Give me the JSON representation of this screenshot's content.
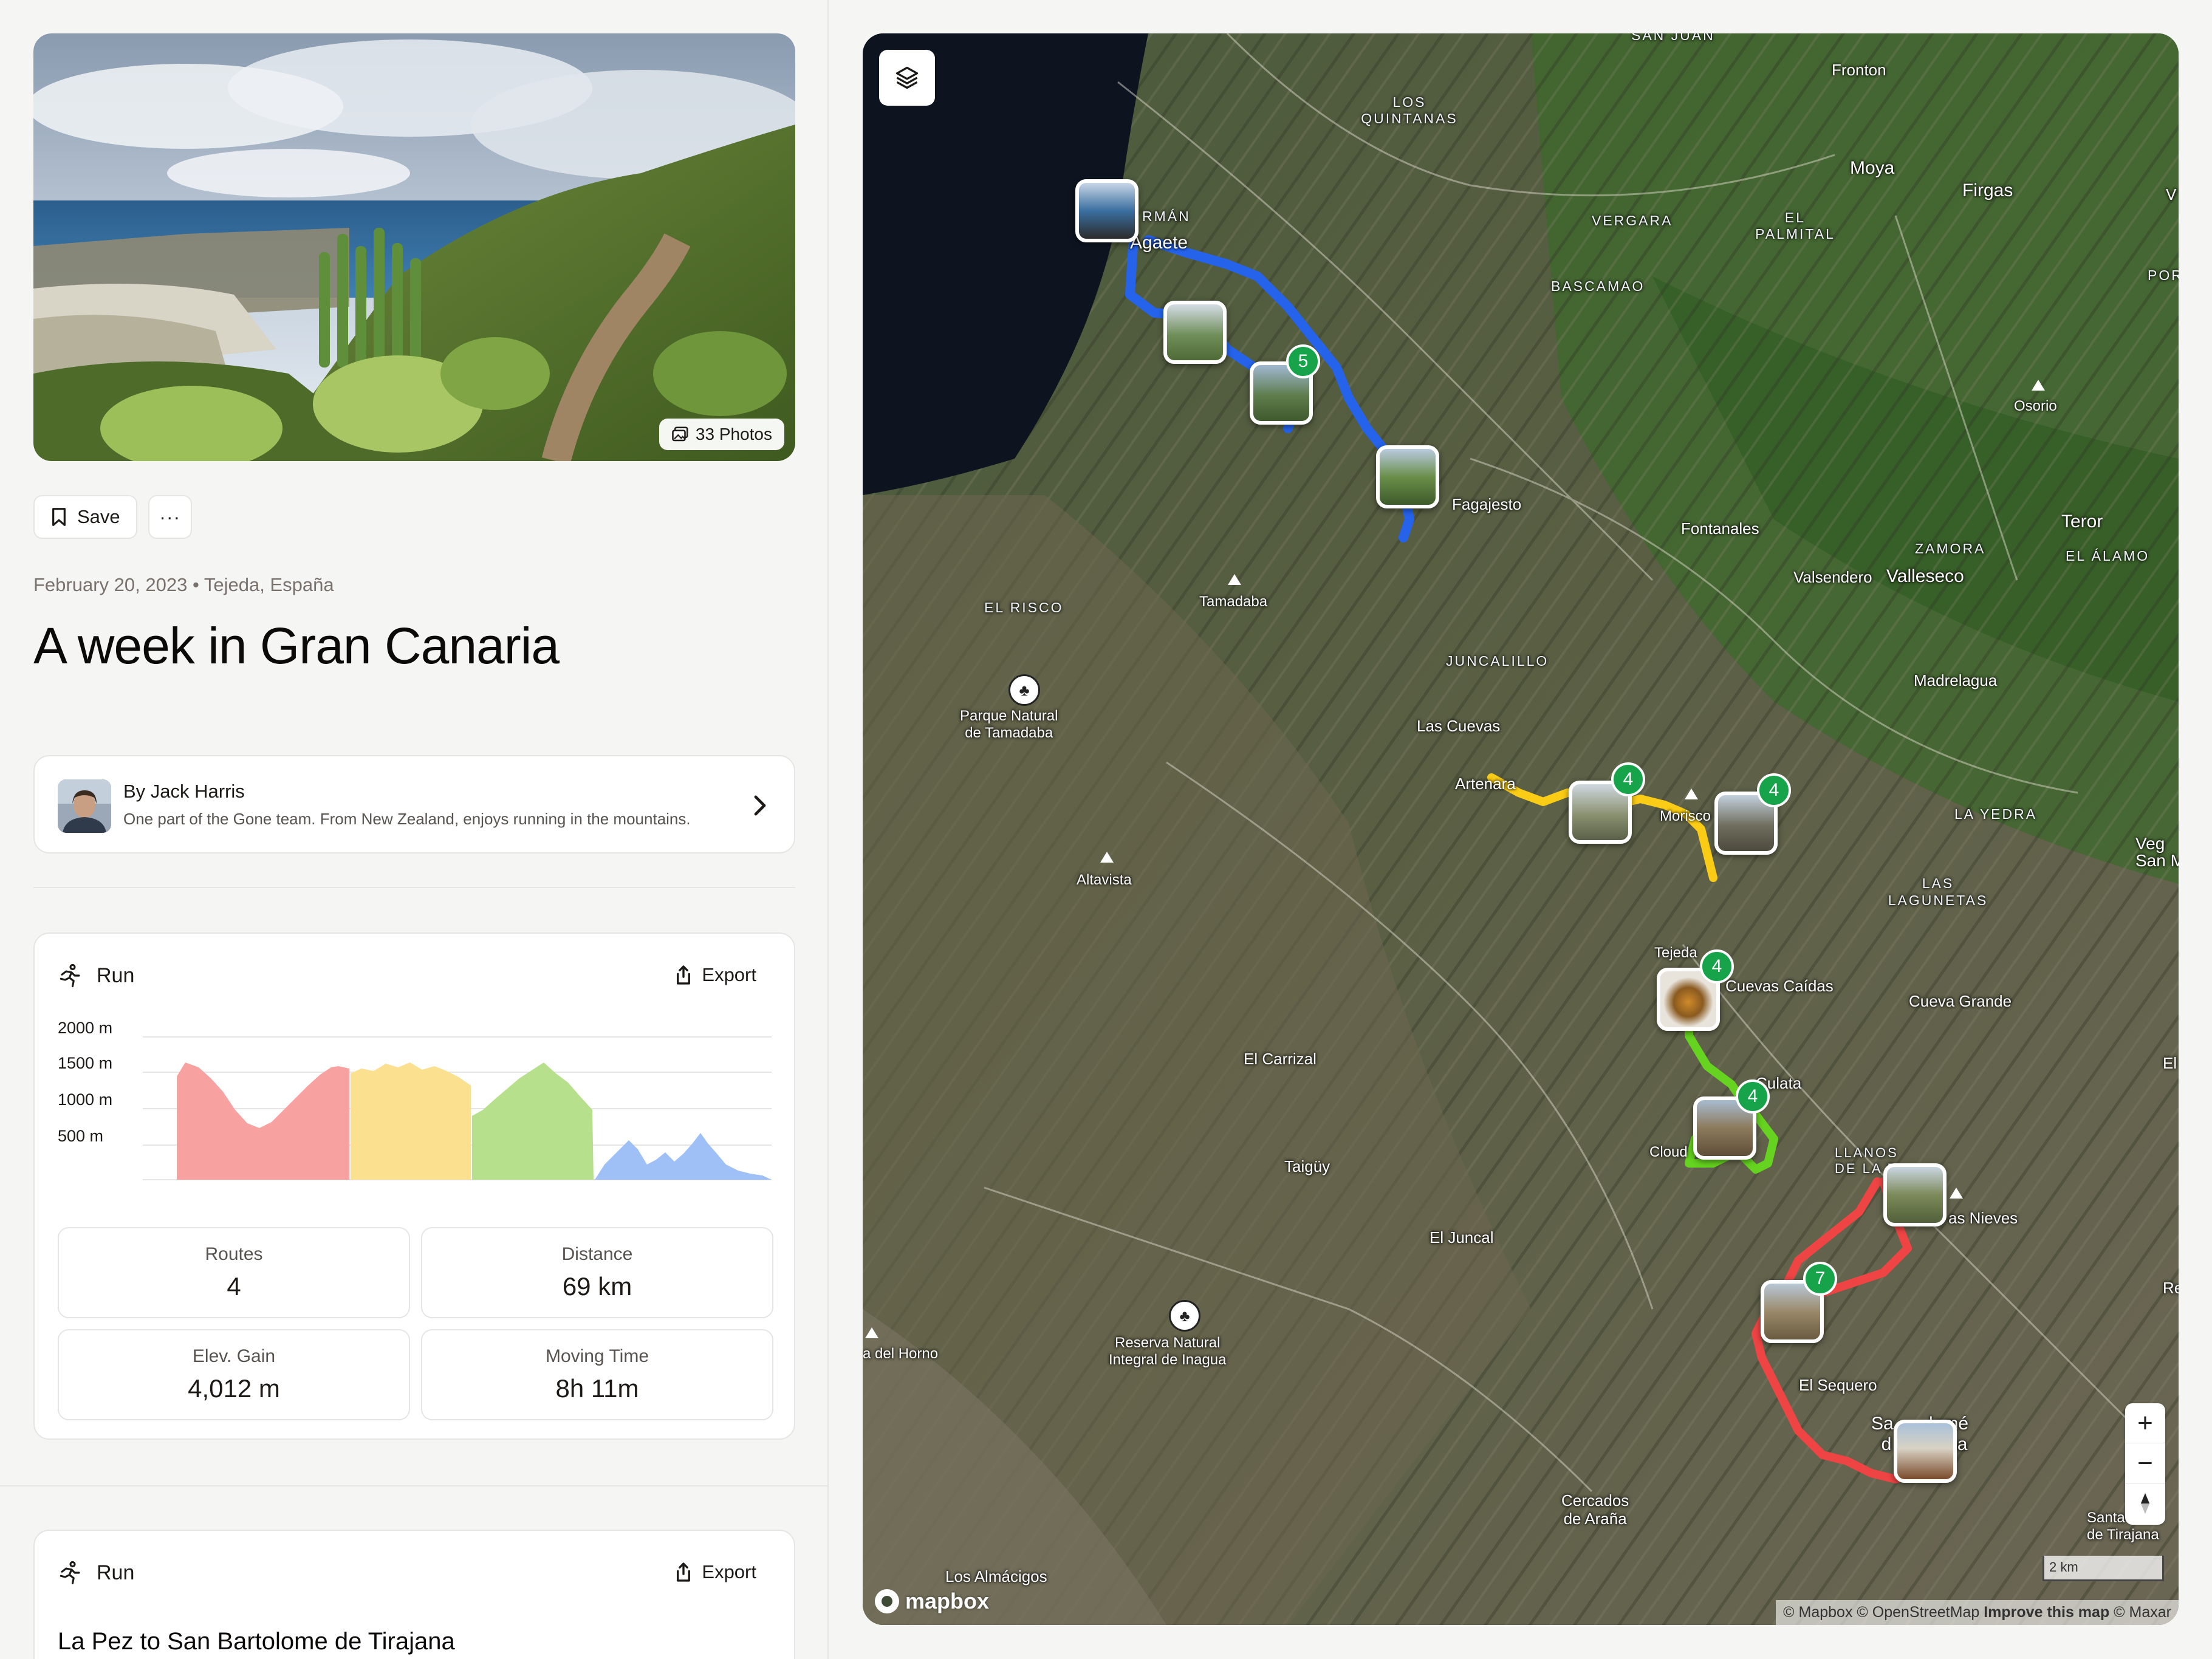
{
  "hero": {
    "photos_label": "33 Photos"
  },
  "actions": {
    "save_label": "Save",
    "more_label": "···"
  },
  "trip": {
    "meta": "February 20, 2023 • Tejeda, España",
    "title": "A week in Gran Canaria"
  },
  "author": {
    "name": "By Jack Harris",
    "bio": "One part of the Gone team. From New Zealand, enjoys running in the mountains."
  },
  "summary_card": {
    "activity": "Run",
    "export_label": "Export",
    "elevation_axis": [
      "2000 m",
      "1500 m",
      "1000 m",
      "500 m"
    ],
    "segment_colors": [
      "#f7a1a1",
      "#fbe08f",
      "#b7e08c",
      "#9ec0f7"
    ],
    "stats": [
      {
        "label": "Routes",
        "value": "4"
      },
      {
        "label": "Distance",
        "value": "69 km"
      },
      {
        "label": "Elev. Gain",
        "value": "4,012 m"
      },
      {
        "label": "Moving Time",
        "value": "8h 11m"
      }
    ]
  },
  "route_card": {
    "activity": "Run",
    "export_label": "Export",
    "title": "La Pez to San Bartolome de Tirajana"
  },
  "map": {
    "places": [
      {
        "id": "san-juan",
        "text": "SAN JUAN",
        "caps": true
      },
      {
        "id": "los-quintanas",
        "text": "LOS QUINTANAS",
        "caps": true
      },
      {
        "id": "fronton",
        "text": "Fronton",
        "caps": false
      },
      {
        "id": "moya",
        "text": "Moya",
        "caps": false
      },
      {
        "id": "firgas",
        "text": "Firgas",
        "caps": false
      },
      {
        "id": "vergara",
        "text": "VERGARA",
        "caps": true
      },
      {
        "id": "el-palmital",
        "text": "EL PALMITAL",
        "caps": true
      },
      {
        "id": "bascamao",
        "text": "BASCAMAO",
        "caps": true
      },
      {
        "id": "german",
        "text": "RMÁN",
        "caps": true
      },
      {
        "id": "agaete",
        "text": "Agaete",
        "caps": false
      },
      {
        "id": "osorio",
        "text": "Osorio",
        "caps": false
      },
      {
        "id": "fagajesto",
        "text": "Fagajesto",
        "caps": false
      },
      {
        "id": "fontanales",
        "text": "Fontanales",
        "caps": false
      },
      {
        "id": "zamora",
        "text": "ZAMORA",
        "caps": true
      },
      {
        "id": "valsendero",
        "text": "Valsendero",
        "caps": false
      },
      {
        "id": "valleseco",
        "text": "Valleseco",
        "caps": false
      },
      {
        "id": "teror",
        "text": "Teror",
        "caps": false
      },
      {
        "id": "el-alamo",
        "text": "EL ÁLAMO",
        "caps": true
      },
      {
        "id": "el-risco",
        "text": "EL RISCO",
        "caps": true
      },
      {
        "id": "tamadaba",
        "text": "Tamadaba",
        "caps": false
      },
      {
        "id": "juncalillo",
        "text": "JUNCALILLO",
        "caps": true
      },
      {
        "id": "parque-tamadaba",
        "text": "Parque Natural\nde Tamadaba",
        "caps": false
      },
      {
        "id": "madrelagua",
        "text": "Madrelagua",
        "caps": false
      },
      {
        "id": "las-cuevas",
        "text": "Las Cuevas",
        "caps": false
      },
      {
        "id": "artenara",
        "text": "Artenara",
        "caps": false
      },
      {
        "id": "moriscos",
        "text": "Morisco",
        "caps": false
      },
      {
        "id": "la-yedra",
        "text": "LA YEDRA",
        "caps": true
      },
      {
        "id": "vega-san",
        "text": "Veg\nSan M",
        "caps": false
      },
      {
        "id": "altavista",
        "text": "Altavista",
        "caps": false
      },
      {
        "id": "las-lagunetas",
        "text": "LAS\nLAGUNETAS",
        "caps": true
      },
      {
        "id": "tejeda",
        "text": "Tejeda",
        "caps": false
      },
      {
        "id": "cuevas-caidas",
        "text": "Cuevas Caídas",
        "caps": false
      },
      {
        "id": "cueva-grande",
        "text": "Cueva Grande",
        "caps": false
      },
      {
        "id": "el-carrizal",
        "text": "El Carrizal",
        "caps": false
      },
      {
        "id": "culata",
        "text": "Culata",
        "caps": false
      },
      {
        "id": "el",
        "text": "El",
        "caps": false
      },
      {
        "id": "taiguy",
        "text": "Taigüy",
        "caps": false
      },
      {
        "id": "cloud",
        "text": "Cloud",
        "caps": false
      },
      {
        "id": "llanos",
        "text": "LLANOS\nDE LA P",
        "caps": true
      },
      {
        "id": "las-nieves",
        "text": "as Nieves",
        "caps": false
      },
      {
        "id": "el-juncal",
        "text": "El Juncal",
        "caps": false
      },
      {
        "id": "re",
        "text": "Re",
        "caps": false
      },
      {
        "id": "del-horno",
        "text": "a del Horno",
        "caps": false
      },
      {
        "id": "inagua",
        "text": "Reserva Natural\nIntegral de Inagua",
        "caps": false
      },
      {
        "id": "el-sequero",
        "text": "El Sequero",
        "caps": false
      },
      {
        "id": "san-bartolome",
        "text": "Sa       lomé\n  d           na",
        "caps": false
      },
      {
        "id": "cercados",
        "text": "Cercados\nde Araña",
        "caps": false
      },
      {
        "id": "santa-lucia",
        "text": "Santa\nde Tirajana",
        "caps": false
      },
      {
        "id": "los-almacigos",
        "text": "Los Almácigos",
        "caps": false
      },
      {
        "id": "por",
        "text": "POR",
        "caps": true
      },
      {
        "id": "v",
        "text": "V",
        "caps": false
      }
    ],
    "badges": [
      "5",
      "4",
      "4",
      "4",
      "4",
      "7"
    ],
    "route_colors": {
      "blue": "#2563eb",
      "yellow": "#facc15",
      "green": "#65d31f",
      "red": "#ef4444"
    },
    "zoom": {
      "in": "+",
      "out": "−"
    },
    "scale_label": "2 km",
    "logo_text": "mapbox",
    "attribution": {
      "part1": "© Mapbox © OpenStreetMap",
      "improve": "Improve this map",
      "part2": "© Maxar"
    }
  }
}
